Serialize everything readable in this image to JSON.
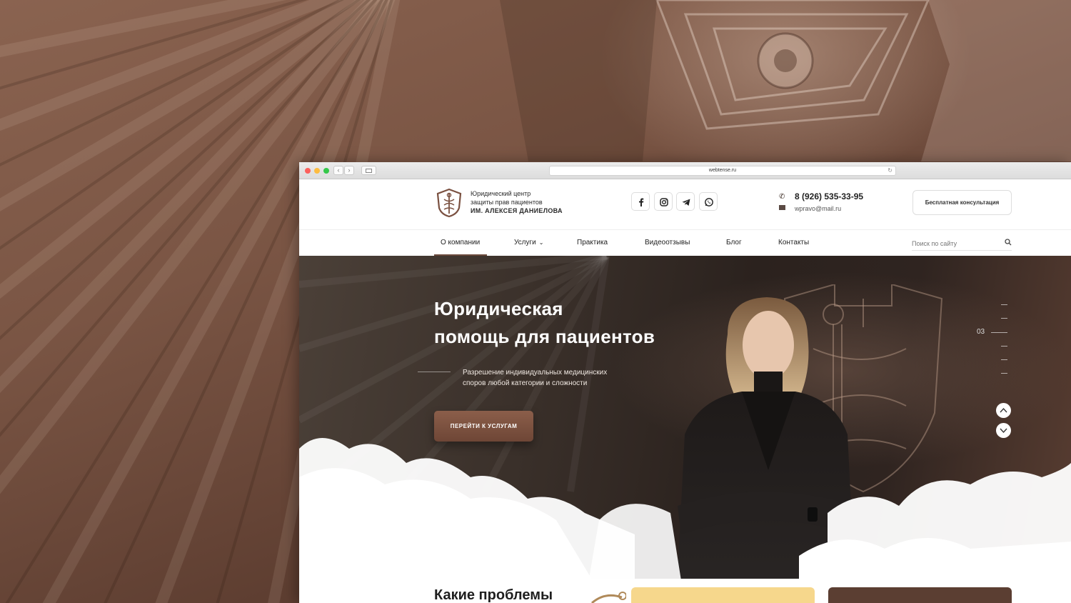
{
  "browser": {
    "url": "webtense.ru"
  },
  "header": {
    "logo_line1": "Юридический центр",
    "logo_line2": "защиты прав пациентов",
    "logo_line3": "ИМ. АЛЕКСЕЯ ДАНИЕЛОВА",
    "phone": "8 (926) 535-33-95",
    "email": "wpravo@mail.ru",
    "consult_label": "Бесплатная консультация",
    "social": [
      "facebook-icon",
      "instagram-icon",
      "telegram-icon",
      "whatsapp-icon"
    ]
  },
  "nav": {
    "items": [
      {
        "label": "О компании",
        "active": true
      },
      {
        "label": "Услуги",
        "has_dropdown": true
      },
      {
        "label": "Практика"
      },
      {
        "label": "Видеоотзывы"
      },
      {
        "label": "Блог"
      },
      {
        "label": "Контакты"
      }
    ],
    "search_placeholder": "Поиск по сайту"
  },
  "hero": {
    "title_line1": "Юридическая",
    "title_line2": "помощь для пациентов",
    "subtitle_line1": "Разрешение индивидуальных медицинских",
    "subtitle_line2": "споров любой категории и сложности",
    "cta_label": "ПЕРЕЙТИ К УСЛУГАМ",
    "slide_number": "03"
  },
  "section": {
    "title": "Какие проблемы"
  },
  "colors": {
    "brand_brown": "#6b4a3c",
    "accent_yellow": "#f6d78c",
    "dark_brown": "#5b3e32"
  }
}
